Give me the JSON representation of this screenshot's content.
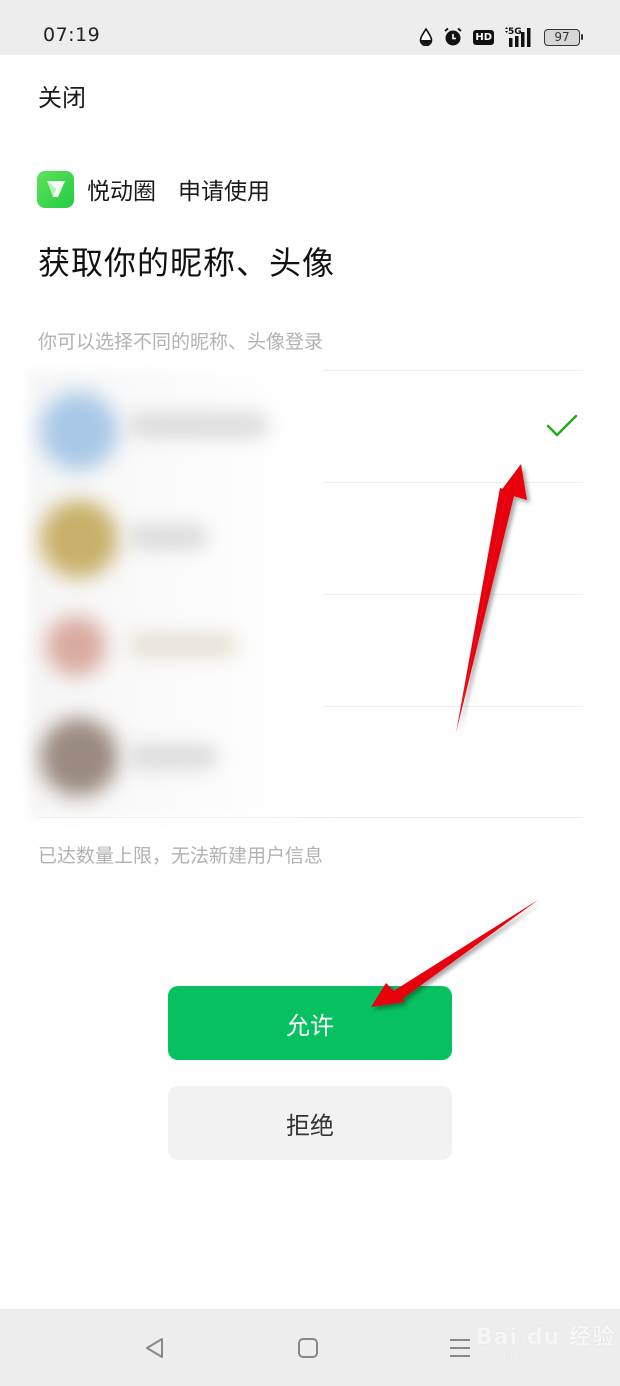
{
  "status_bar": {
    "time": "07:19",
    "icons": [
      "water-drop-icon",
      "alarm-icon",
      "hd-icon",
      "5g-signal-icon",
      "battery-icon"
    ],
    "hd_label": "HD",
    "network_label": "5G",
    "battery_level": "97"
  },
  "header": {
    "close_label": "关闭"
  },
  "app": {
    "name": "悦动圈",
    "request_label": "申请使用",
    "icon_color": "#2fd24a"
  },
  "title": "获取你的昵称、头像",
  "subtitle": "你可以选择不同的昵称、头像登录",
  "profiles": [
    {
      "nickname": "",
      "avatar_color": "#a9c8e6",
      "selected": true
    },
    {
      "nickname": "",
      "avatar_color": "#c8b06a",
      "selected": false
    },
    {
      "nickname": "",
      "avatar_color": "#d9aaa0",
      "selected": false
    },
    {
      "nickname": "",
      "avatar_color": "#9a8a80",
      "selected": false
    }
  ],
  "limit_note": "已达数量上限，无法新建用户信息",
  "buttons": {
    "allow_label": "允许",
    "deny_label": "拒绝"
  },
  "colors": {
    "accent_green": "#07c160",
    "check_green": "#1aad19",
    "annotation_red": "#e8000b"
  },
  "nav_bar": {
    "back": "back-icon",
    "home": "home-icon",
    "recents": "menu-icon"
  },
  "watermark": {
    "brand": "Bai du 经验",
    "url": "jingyan.baidu.com"
  }
}
